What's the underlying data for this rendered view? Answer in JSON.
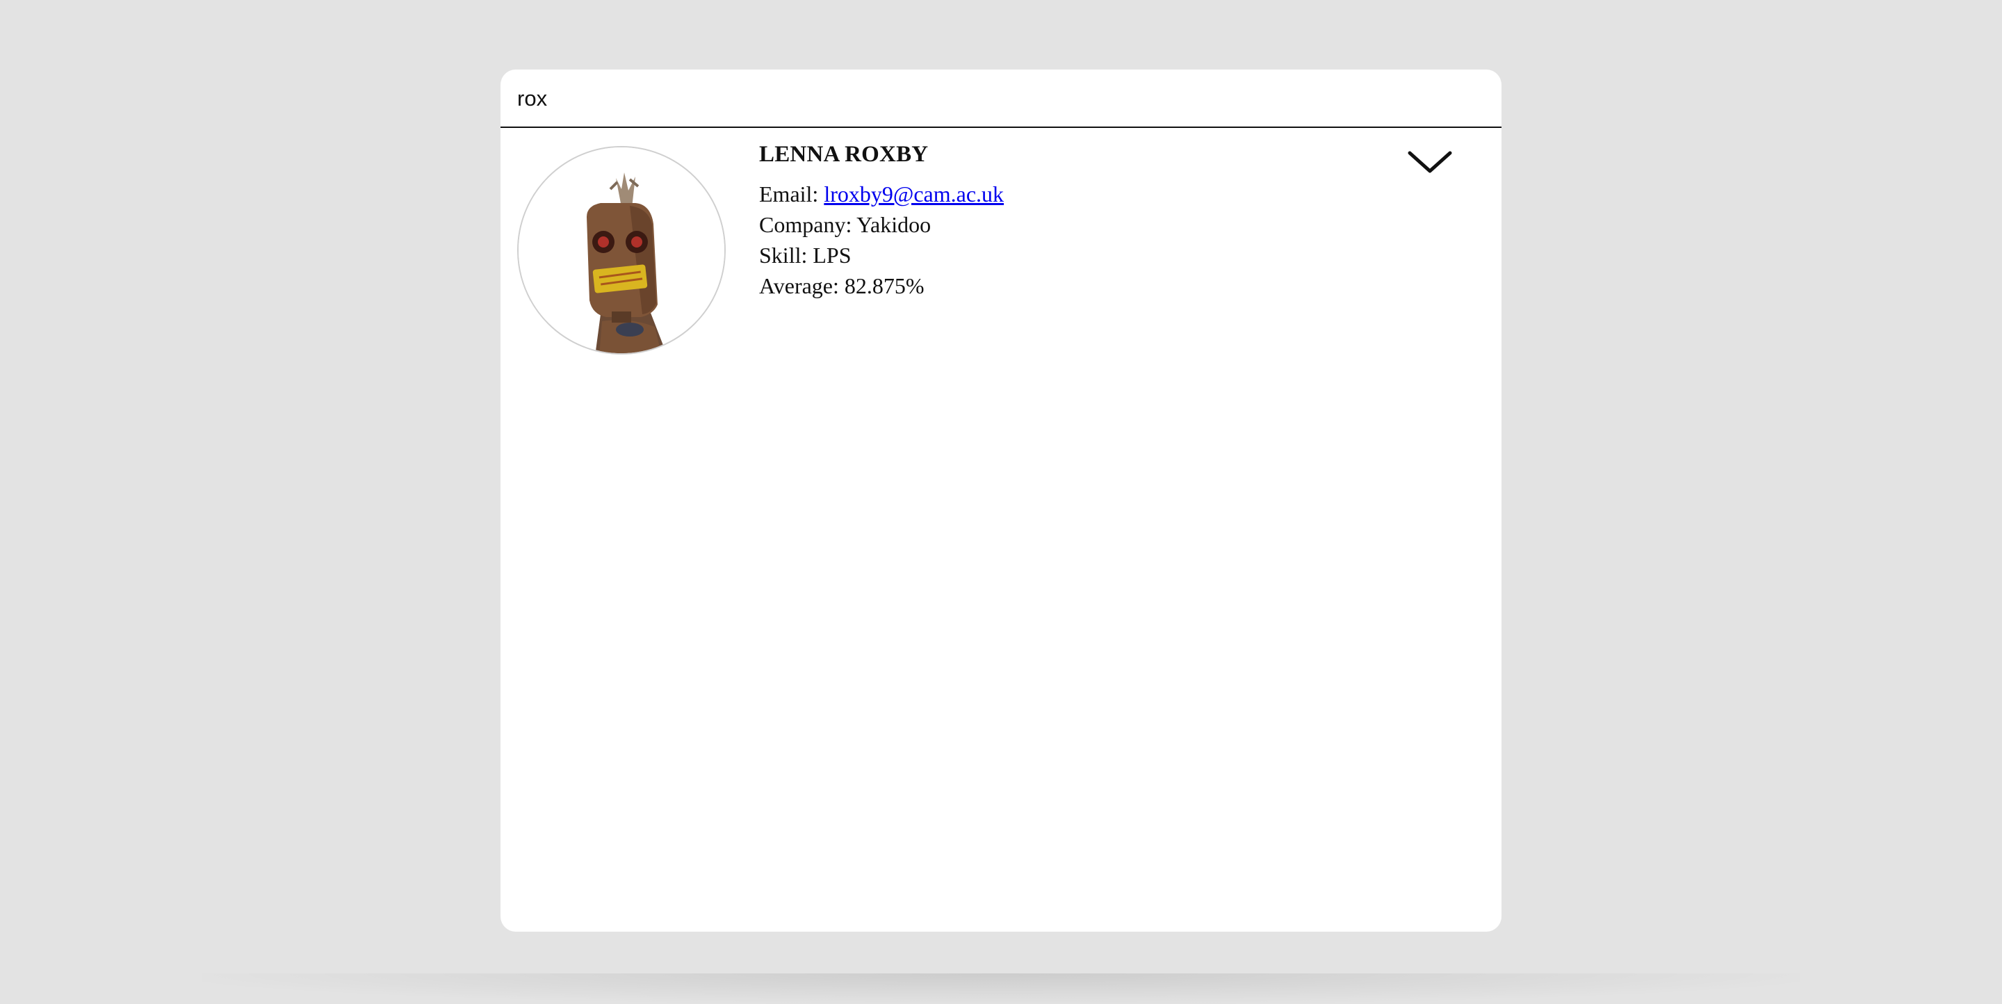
{
  "search": {
    "value": "rox",
    "placeholder": ""
  },
  "student": {
    "name": "LENNA ROXBY",
    "email_label": "Email:",
    "email": "lroxby9@cam.ac.uk",
    "company_label": "Company:",
    "company": "Yakidoo",
    "skill_label": "Skill:",
    "skill": "LPS",
    "average_label": "Average:",
    "average": "82.875%",
    "toggle_icon": "chevron-down-icon",
    "avatar_icon": "robot-avatar"
  },
  "colors": {
    "background": "#e3e3e3",
    "card": "#ffffff",
    "link": "#0000ee"
  }
}
